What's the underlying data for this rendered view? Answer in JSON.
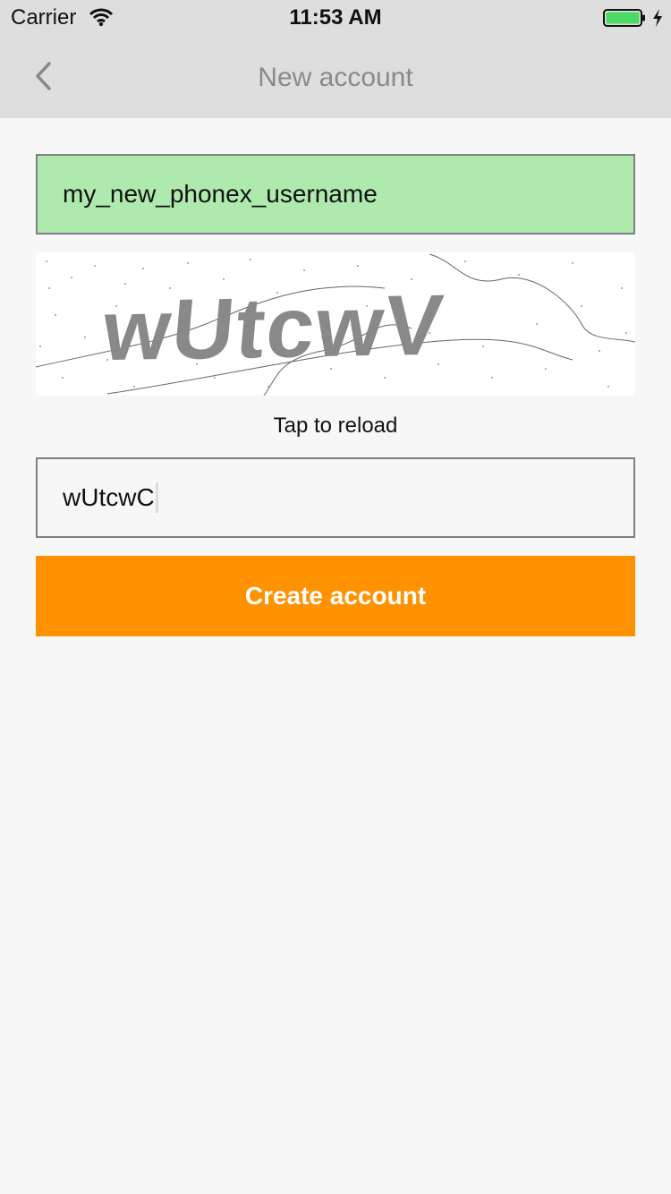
{
  "status_bar": {
    "carrier": "Carrier",
    "time": "11:53 AM",
    "wifi_icon": "wifi-icon",
    "battery_icon": "battery-icon",
    "charging_icon": "charging-bolt-icon",
    "battery_color": "#4cd964"
  },
  "nav": {
    "back_icon": "chevron-left-icon",
    "title": "New account"
  },
  "form": {
    "username_value": "my_new_phonex_username",
    "username_bg": "#aeeaae",
    "captcha_text": "wUtcwV",
    "tap_to_reload": "Tap to reload",
    "captcha_input_value": "wUtcwC",
    "create_button_label": "Create account",
    "accent_color": "#ff9200"
  }
}
